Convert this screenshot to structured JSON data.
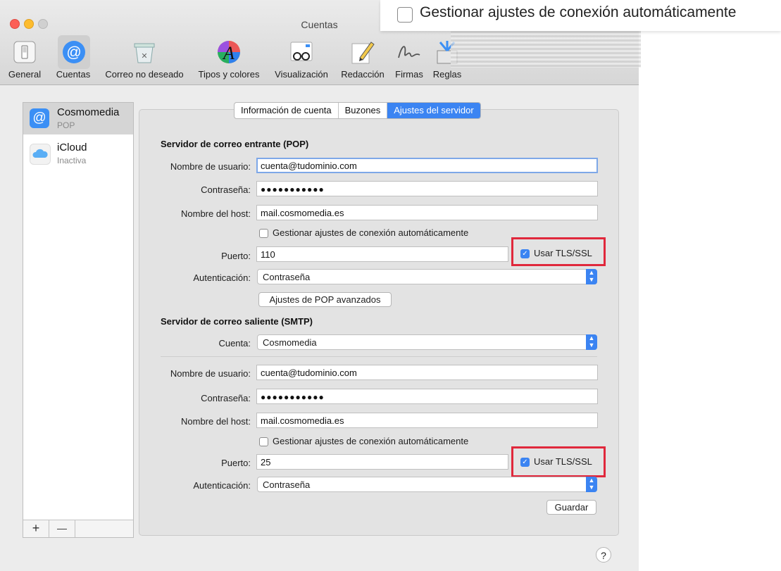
{
  "window": {
    "title": "Cuentas"
  },
  "zoom": {
    "checkbox_label": "Gestionar ajustes de conexión automáticamente"
  },
  "toolbar": {
    "items": [
      {
        "label": "General",
        "icon": "switch-icon"
      },
      {
        "label": "Cuentas",
        "icon": "at-icon"
      },
      {
        "label": "Correo no deseado",
        "icon": "junk-mail-icon"
      },
      {
        "label": "Tipos y colores",
        "icon": "fonts-colors-icon"
      },
      {
        "label": "Visualización",
        "icon": "glasses-icon"
      },
      {
        "label": "Redacción",
        "icon": "pencil-icon"
      },
      {
        "label": "Firmas",
        "icon": "signature-icon"
      },
      {
        "label": "Reglas",
        "icon": "rules-icon"
      }
    ]
  },
  "sidebar": {
    "accounts": [
      {
        "name": "Cosmomedia",
        "type": "POP",
        "selected": true
      },
      {
        "name": "iCloud",
        "type": "Inactiva",
        "selected": false
      }
    ],
    "add_label": "+",
    "remove_label": "—"
  },
  "tabs": [
    "Información de cuenta",
    "Buzones",
    "Ajustes del servidor"
  ],
  "incoming": {
    "title": "Servidor de correo entrante (POP)",
    "user_label": "Nombre de usuario:",
    "user_value": "cuenta@tudominio.com",
    "password_label": "Contraseña:",
    "password_value": "●●●●●●●●●●●",
    "host_label": "Nombre del host:",
    "host_value": "mail.cosmomedia.es",
    "auto_label": "Gestionar ajustes de conexión automáticamente",
    "port_label": "Puerto:",
    "port_value": "110",
    "tls_label": "Usar TLS/SSL",
    "auth_label": "Autenticación:",
    "auth_value": "Contraseña",
    "advanced_button": "Ajustes de POP avanzados"
  },
  "outgoing": {
    "title": "Servidor de correo saliente (SMTP)",
    "account_label": "Cuenta:",
    "account_value": "Cosmomedia",
    "user_label": "Nombre de usuario:",
    "user_value": "cuenta@tudominio.com",
    "password_label": "Contraseña:",
    "password_value": "●●●●●●●●●●●",
    "host_label": "Nombre del host:",
    "host_value": "mail.cosmomedia.es",
    "auto_label": "Gestionar ajustes de conexión automáticamente",
    "port_label": "Puerto:",
    "port_value": "25",
    "tls_label": "Usar TLS/SSL",
    "auth_label": "Autenticación:",
    "auth_value": "Contraseña"
  },
  "save_button": "Guardar",
  "help_label": "?",
  "colors": {
    "accent": "#3b84f2",
    "highlight": "#e0283c"
  }
}
